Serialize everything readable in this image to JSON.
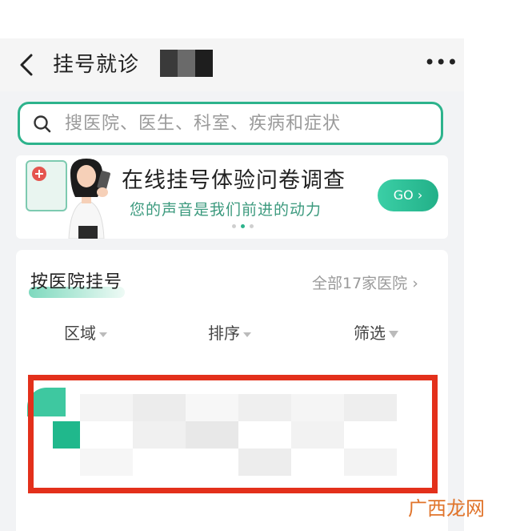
{
  "header": {
    "title": "挂号就诊",
    "more_label": "•••"
  },
  "search": {
    "placeholder": "搜医院、医生、科室、疾病和症状"
  },
  "banner": {
    "title": "在线挂号体验问卷调查",
    "subtitle": "您的声音是我们前进的动力",
    "button_label": "GO",
    "button_chevron": "›"
  },
  "hospitals": {
    "section_title": "按医院挂号",
    "all_link": "全部17家医院",
    "all_chevron": "›",
    "filters": [
      {
        "label": "区域"
      },
      {
        "label": "排序"
      },
      {
        "label": "筛选"
      }
    ]
  },
  "watermark": "广西龙网",
  "colors": {
    "accent": "#2db38c",
    "highlight_border": "#e3301b"
  }
}
